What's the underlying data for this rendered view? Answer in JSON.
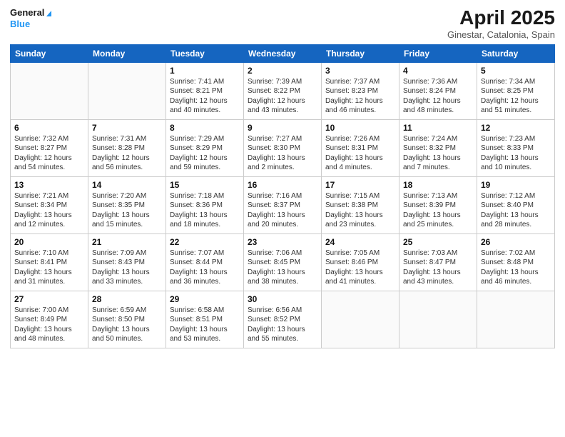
{
  "header": {
    "logo_line1": "General",
    "logo_line2": "Blue",
    "main_title": "April 2025",
    "subtitle": "Ginestar, Catalonia, Spain"
  },
  "weekdays": [
    "Sunday",
    "Monday",
    "Tuesday",
    "Wednesday",
    "Thursday",
    "Friday",
    "Saturday"
  ],
  "weeks": [
    [
      {
        "day": "",
        "detail": ""
      },
      {
        "day": "",
        "detail": ""
      },
      {
        "day": "1",
        "detail": "Sunrise: 7:41 AM\nSunset: 8:21 PM\nDaylight: 12 hours and 40 minutes."
      },
      {
        "day": "2",
        "detail": "Sunrise: 7:39 AM\nSunset: 8:22 PM\nDaylight: 12 hours and 43 minutes."
      },
      {
        "day": "3",
        "detail": "Sunrise: 7:37 AM\nSunset: 8:23 PM\nDaylight: 12 hours and 46 minutes."
      },
      {
        "day": "4",
        "detail": "Sunrise: 7:36 AM\nSunset: 8:24 PM\nDaylight: 12 hours and 48 minutes."
      },
      {
        "day": "5",
        "detail": "Sunrise: 7:34 AM\nSunset: 8:25 PM\nDaylight: 12 hours and 51 minutes."
      }
    ],
    [
      {
        "day": "6",
        "detail": "Sunrise: 7:32 AM\nSunset: 8:27 PM\nDaylight: 12 hours and 54 minutes."
      },
      {
        "day": "7",
        "detail": "Sunrise: 7:31 AM\nSunset: 8:28 PM\nDaylight: 12 hours and 56 minutes."
      },
      {
        "day": "8",
        "detail": "Sunrise: 7:29 AM\nSunset: 8:29 PM\nDaylight: 12 hours and 59 minutes."
      },
      {
        "day": "9",
        "detail": "Sunrise: 7:27 AM\nSunset: 8:30 PM\nDaylight: 13 hours and 2 minutes."
      },
      {
        "day": "10",
        "detail": "Sunrise: 7:26 AM\nSunset: 8:31 PM\nDaylight: 13 hours and 4 minutes."
      },
      {
        "day": "11",
        "detail": "Sunrise: 7:24 AM\nSunset: 8:32 PM\nDaylight: 13 hours and 7 minutes."
      },
      {
        "day": "12",
        "detail": "Sunrise: 7:23 AM\nSunset: 8:33 PM\nDaylight: 13 hours and 10 minutes."
      }
    ],
    [
      {
        "day": "13",
        "detail": "Sunrise: 7:21 AM\nSunset: 8:34 PM\nDaylight: 13 hours and 12 minutes."
      },
      {
        "day": "14",
        "detail": "Sunrise: 7:20 AM\nSunset: 8:35 PM\nDaylight: 13 hours and 15 minutes."
      },
      {
        "day": "15",
        "detail": "Sunrise: 7:18 AM\nSunset: 8:36 PM\nDaylight: 13 hours and 18 minutes."
      },
      {
        "day": "16",
        "detail": "Sunrise: 7:16 AM\nSunset: 8:37 PM\nDaylight: 13 hours and 20 minutes."
      },
      {
        "day": "17",
        "detail": "Sunrise: 7:15 AM\nSunset: 8:38 PM\nDaylight: 13 hours and 23 minutes."
      },
      {
        "day": "18",
        "detail": "Sunrise: 7:13 AM\nSunset: 8:39 PM\nDaylight: 13 hours and 25 minutes."
      },
      {
        "day": "19",
        "detail": "Sunrise: 7:12 AM\nSunset: 8:40 PM\nDaylight: 13 hours and 28 minutes."
      }
    ],
    [
      {
        "day": "20",
        "detail": "Sunrise: 7:10 AM\nSunset: 8:41 PM\nDaylight: 13 hours and 31 minutes."
      },
      {
        "day": "21",
        "detail": "Sunrise: 7:09 AM\nSunset: 8:43 PM\nDaylight: 13 hours and 33 minutes."
      },
      {
        "day": "22",
        "detail": "Sunrise: 7:07 AM\nSunset: 8:44 PM\nDaylight: 13 hours and 36 minutes."
      },
      {
        "day": "23",
        "detail": "Sunrise: 7:06 AM\nSunset: 8:45 PM\nDaylight: 13 hours and 38 minutes."
      },
      {
        "day": "24",
        "detail": "Sunrise: 7:05 AM\nSunset: 8:46 PM\nDaylight: 13 hours and 41 minutes."
      },
      {
        "day": "25",
        "detail": "Sunrise: 7:03 AM\nSunset: 8:47 PM\nDaylight: 13 hours and 43 minutes."
      },
      {
        "day": "26",
        "detail": "Sunrise: 7:02 AM\nSunset: 8:48 PM\nDaylight: 13 hours and 46 minutes."
      }
    ],
    [
      {
        "day": "27",
        "detail": "Sunrise: 7:00 AM\nSunset: 8:49 PM\nDaylight: 13 hours and 48 minutes."
      },
      {
        "day": "28",
        "detail": "Sunrise: 6:59 AM\nSunset: 8:50 PM\nDaylight: 13 hours and 50 minutes."
      },
      {
        "day": "29",
        "detail": "Sunrise: 6:58 AM\nSunset: 8:51 PM\nDaylight: 13 hours and 53 minutes."
      },
      {
        "day": "30",
        "detail": "Sunrise: 6:56 AM\nSunset: 8:52 PM\nDaylight: 13 hours and 55 minutes."
      },
      {
        "day": "",
        "detail": ""
      },
      {
        "day": "",
        "detail": ""
      },
      {
        "day": "",
        "detail": ""
      }
    ]
  ]
}
